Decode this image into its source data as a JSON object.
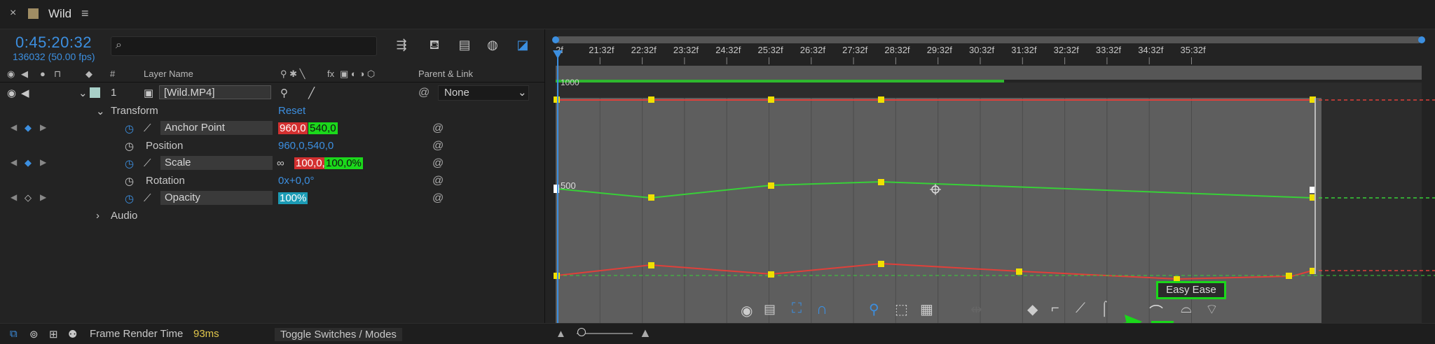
{
  "titlebar": {
    "close": "×",
    "title": "Wild",
    "menu": "≡"
  },
  "header": {
    "timecode": "0:45:20:32",
    "fps": "136032 (50.00 fps)",
    "search_placeholder": ""
  },
  "columns": {
    "hash": "#",
    "layer_name": "Layer Name",
    "parent_link": "Parent & Link",
    "fx": "fx"
  },
  "layer": {
    "number": "1",
    "name": "[Wild.MP4]",
    "parent": "None"
  },
  "transform": {
    "label": "Transform",
    "reset": "Reset"
  },
  "properties": [
    {
      "name": "Anchor Point",
      "v1": "960,0",
      "v2": "540,0"
    },
    {
      "name": "Position",
      "value": "960,0,540,0"
    },
    {
      "name": "Scale",
      "v1": "100,0,",
      "v2": "100,0%"
    },
    {
      "name": "Rotation",
      "value": "0x+0,0°"
    },
    {
      "name": "Opacity",
      "value": "100%"
    }
  ],
  "audio": {
    "label": "Audio"
  },
  "ruler": {
    "ticks": [
      "2f",
      "21:32f",
      "22:32f",
      "23:32f",
      "24:32f",
      "25:32f",
      "26:32f",
      "27:32f",
      "28:32f",
      "29:32f",
      "30:32f",
      "31:32f",
      "32:32f",
      "33:32f",
      "34:32f",
      "35:32f"
    ]
  },
  "graph": {
    "label_top": "1000",
    "label_mid": "500"
  },
  "tooltip": {
    "easy_ease": "Easy Ease"
  },
  "status": {
    "frame_render_label": "Frame Render Time",
    "frame_render_value": "93ms",
    "toggle": "Toggle Switches / Modes"
  },
  "colors": {
    "accent": "#3c8fe0",
    "keyframe": "#f0e000",
    "red_curve": "#e0403a",
    "green_curve": "#38d038",
    "highlight": "#1ad81a"
  }
}
